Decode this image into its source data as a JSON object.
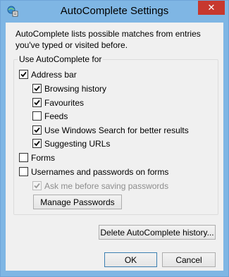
{
  "window": {
    "title": "AutoComplete Settings",
    "close_glyph": "✕",
    "icon": "autocomplete-settings-icon"
  },
  "intro_text": "AutoComplete lists possible matches from entries you've typed or visited before.",
  "group": {
    "label": "Use AutoComplete for"
  },
  "options": {
    "address_bar": {
      "label": "Address bar",
      "checked": true
    },
    "browsing_history": {
      "label": "Browsing history",
      "checked": true
    },
    "favourites": {
      "label": "Favourites",
      "checked": true
    },
    "feeds": {
      "label": "Feeds",
      "checked": false
    },
    "windows_search": {
      "label": "Use Windows Search for better results",
      "checked": true
    },
    "suggesting_urls": {
      "label": "Suggesting URLs",
      "checked": true
    },
    "forms": {
      "label": "Forms",
      "checked": false
    },
    "usernames_passwords": {
      "label": "Usernames and passwords on forms",
      "checked": false
    },
    "ask_before_saving": {
      "label": "Ask me before saving passwords",
      "checked": true,
      "disabled": true
    }
  },
  "buttons": {
    "manage_passwords": "Manage Passwords",
    "delete_history": "Delete AutoComplete history...",
    "ok": "OK",
    "cancel": "Cancel"
  },
  "colors": {
    "titlebar": "#7fb6e4",
    "close_button": "#c7382e",
    "dialog_bg": "#f0f0f0"
  }
}
